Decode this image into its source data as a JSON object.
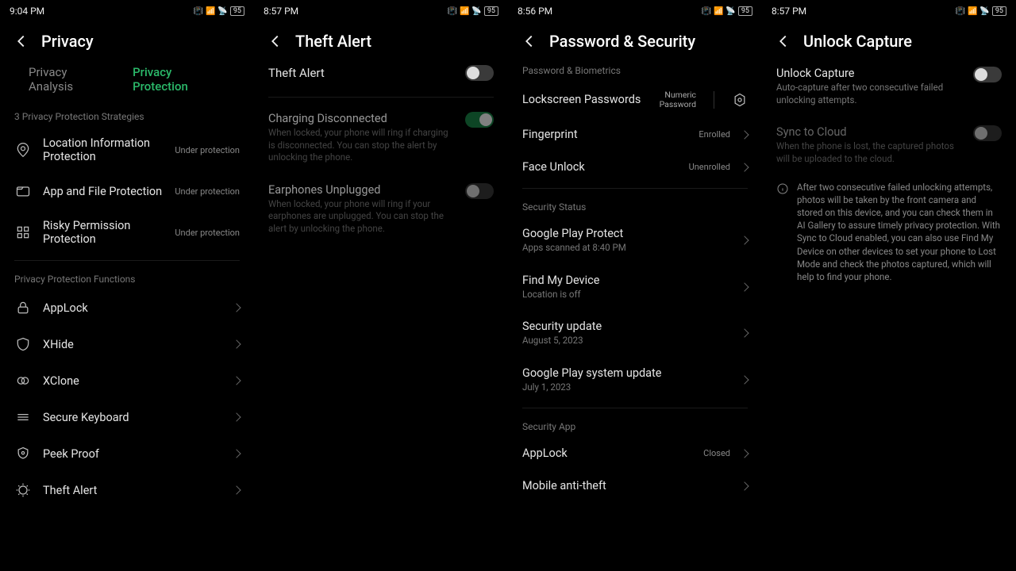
{
  "screens": [
    {
      "statusbar": {
        "time": "9:04 PM",
        "battery": "95"
      },
      "header": "Privacy",
      "tabs": {
        "analysis": "Privacy Analysis",
        "protection": "Privacy Protection"
      },
      "section1_label": "3 Privacy Protection Strategies",
      "strategies": [
        {
          "title": "Location Information Protection",
          "status": "Under protection"
        },
        {
          "title": "App and File Protection",
          "status": "Under protection"
        },
        {
          "title": "Risky Permission Protection",
          "status": "Under protection"
        }
      ],
      "section2_label": "Privacy Protection Functions",
      "functions": [
        {
          "title": "AppLock"
        },
        {
          "title": "XHide"
        },
        {
          "title": "XClone"
        },
        {
          "title": "Secure Keyboard"
        },
        {
          "title": "Peek Proof"
        },
        {
          "title": "Theft Alert"
        }
      ]
    },
    {
      "statusbar": {
        "time": "8:57 PM",
        "battery": "95"
      },
      "header": "Theft Alert",
      "main_toggle": {
        "title": "Theft Alert",
        "on": false
      },
      "items": [
        {
          "title": "Charging Disconnected",
          "sub": "When locked, your phone will ring if charging is disconnected. You can stop the alert by unlocking the phone.",
          "on": true
        },
        {
          "title": "Earphones Unplugged",
          "sub": "When locked, your phone will ring if your earphones are unplugged. You can stop the alert by unlocking the phone.",
          "on": false
        }
      ]
    },
    {
      "statusbar": {
        "time": "8:56 PM",
        "battery": "95"
      },
      "header": "Password & Security",
      "section1_label": "Password & Biometrics",
      "bio": [
        {
          "title": "Lockscreen Passwords",
          "tag1": "Numeric",
          "tag2": "Password"
        },
        {
          "title": "Fingerprint",
          "status": "Enrolled"
        },
        {
          "title": "Face Unlock",
          "status": "Unenrolled"
        }
      ],
      "section2_label": "Security Status",
      "status_items": [
        {
          "title": "Google Play Protect",
          "sub": "Apps scanned at 8:40 PM"
        },
        {
          "title": "Find My Device",
          "sub": "Location is off"
        },
        {
          "title": "Security update",
          "sub": "August 5, 2023"
        },
        {
          "title": "Google Play system update",
          "sub": "July 1, 2023"
        }
      ],
      "section3_label": "Security App",
      "apps": [
        {
          "title": "AppLock",
          "status": "Closed"
        },
        {
          "title": "Mobile anti-theft"
        }
      ]
    },
    {
      "statusbar": {
        "time": "8:57 PM",
        "battery": "95"
      },
      "header": "Unlock Capture",
      "capture": {
        "title": "Unlock Capture",
        "sub": "Auto-capture after two consecutive failed unlocking attempts.",
        "on": false
      },
      "sync": {
        "title": "Sync to Cloud",
        "sub": "When the phone is lost, the captured photos will be uploaded to the cloud.",
        "on": false
      },
      "info": "After two consecutive failed unlocking attempts, photos will be taken by the front camera and stored on this device, and you can check them in AI Gallery to assure timely privacy protection. With Sync to Cloud enabled, you can also use Find My Device on other devices to set your phone to Lost Mode and check the photos captured, which will help to find your phone."
    }
  ]
}
